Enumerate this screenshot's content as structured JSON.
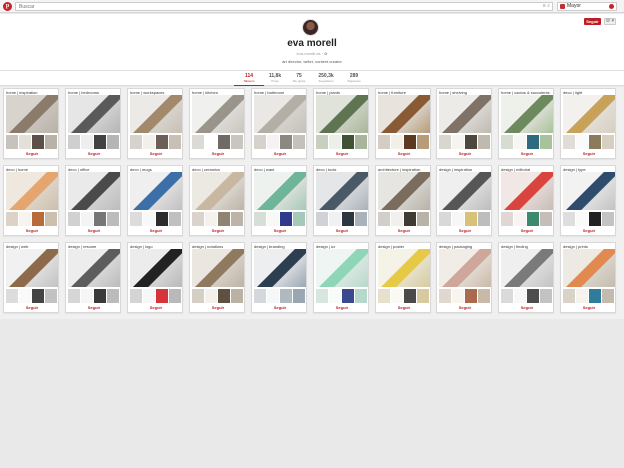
{
  "topbar": {
    "logo_letter": "p",
    "search_placeholder": "Buscar",
    "search_buttons": "≡ ⌕",
    "user_name": "Mayor"
  },
  "profile": {
    "follow_label": "Seguir",
    "settings_label": "⚙ ▾",
    "name": "eva morell",
    "site": "eva-morell.es · ✿",
    "bio": "art director, writer, content curator"
  },
  "stats": [
    {
      "num": "114",
      "label": "Tableros",
      "active": true
    },
    {
      "num": "11,8k",
      "label": "Pines",
      "active": false
    },
    {
      "num": "75",
      "label": "Me gusta",
      "active": false
    },
    {
      "num": "250,3k",
      "label": "Seguidores",
      "active": false
    },
    {
      "num": "289",
      "label": "Siguiendo",
      "active": false
    }
  ],
  "board_follow_label": "Seguir",
  "boards": [
    {
      "title": "home | inspiration",
      "colors": [
        "#d8d3cc",
        "#8b7b6a",
        "#c7c2bb",
        "#e3dfd9",
        "#5e5048",
        "#b9b2a8"
      ]
    },
    {
      "title": "home | bedrooms",
      "colors": [
        "#e6e6e6",
        "#5a5a5a",
        "#cfcfcf",
        "#eeeeee",
        "#424242",
        "#b5b5b5"
      ]
    },
    {
      "title": "home | workspaces",
      "colors": [
        "#eceae6",
        "#a3896c",
        "#d6d2cc",
        "#f2f0ec",
        "#6c6056",
        "#c8c0b4"
      ]
    },
    {
      "title": "home | kitchen",
      "colors": [
        "#f0f0ee",
        "#9a948a",
        "#dcdad6",
        "#ffffff",
        "#6f6a64",
        "#c9c6c0"
      ]
    },
    {
      "title": "home | bathroom",
      "colors": [
        "#e9e8e5",
        "#b3aea6",
        "#d5d2cc",
        "#f4f3f1",
        "#8c8780",
        "#c4c1bb"
      ]
    },
    {
      "title": "home | plants",
      "colors": [
        "#dfe3da",
        "#5f7450",
        "#c9cfbf",
        "#edf0e8",
        "#405135",
        "#a8b59a"
      ]
    },
    {
      "title": "home | furniture",
      "colors": [
        "#e8e4dd",
        "#8a5a34",
        "#d4cdc3",
        "#f2eee8",
        "#5c3a22",
        "#b89b78"
      ]
    },
    {
      "title": "home | shelving",
      "colors": [
        "#ecebe7",
        "#7f7368",
        "#d8d6d1",
        "#f5f4f1",
        "#4f463e",
        "#bfb9b0"
      ]
    },
    {
      "title": "home | cactus & succulents",
      "colors": [
        "#eef0ea",
        "#6d8a5e",
        "#d7dcd0",
        "#f6f7f3",
        "#2f6b7e",
        "#a9c29b"
      ]
    },
    {
      "title": "deco | light",
      "colors": [
        "#f3f1ee",
        "#c9a25a",
        "#e1ddd6",
        "#fafafa",
        "#8c7a5c",
        "#d7cfbf"
      ]
    },
    {
      "title": "deco | home",
      "colors": [
        "#efe8de",
        "#e6a46f",
        "#dcd3c6",
        "#f7f3ee",
        "#b76a3a",
        "#cdbfae"
      ]
    },
    {
      "title": "deco | office",
      "colors": [
        "#eaeaea",
        "#4a4a4a",
        "#d1d1d1",
        "#f4f4f4",
        "#767676",
        "#bcbcbc"
      ]
    },
    {
      "title": "deco | mugs",
      "colors": [
        "#efefef",
        "#3c6ea8",
        "#dcdcdc",
        "#f8f8f8",
        "#2c2c2c",
        "#c0c0c0"
      ]
    },
    {
      "title": "deco | ceramics",
      "colors": [
        "#ece8e2",
        "#c8b8a2",
        "#d9d3cb",
        "#f5f2ee",
        "#8f8372",
        "#bdb3a6"
      ]
    },
    {
      "title": "deco | want",
      "colors": [
        "#eef2ee",
        "#6fb59a",
        "#d6ded8",
        "#f7f9f7",
        "#2f3a8c",
        "#a5c9b9"
      ]
    },
    {
      "title": "deco | tools",
      "colors": [
        "#e4e6e8",
        "#495966",
        "#cfd3d7",
        "#eff1f3",
        "#2c3640",
        "#a9b2ba"
      ]
    },
    {
      "title": "architecture | inspiration",
      "colors": [
        "#e7e5e1",
        "#7a6d5e",
        "#d2cfc9",
        "#f1f0ed",
        "#3e3a34",
        "#b8b2a8"
      ]
    },
    {
      "title": "design | inspiration",
      "colors": [
        "#efefef",
        "#565656",
        "#d8d8d8",
        "#f7f7f7",
        "#d8c27a",
        "#bdbdbd"
      ]
    },
    {
      "title": "design | editorial",
      "colors": [
        "#f1e8e6",
        "#d9443e",
        "#e0d6d3",
        "#f8f4f3",
        "#3b8a6e",
        "#c8bcb8"
      ]
    },
    {
      "title": "design | type",
      "colors": [
        "#f2f2f2",
        "#2f4b6e",
        "#dedede",
        "#fafafa",
        "#222222",
        "#c3c3c3"
      ]
    },
    {
      "title": "design | web",
      "colors": [
        "#f1f1f1",
        "#8c6a4a",
        "#dcdcdc",
        "#f9f9f9",
        "#444444",
        "#c2c2c2"
      ]
    },
    {
      "title": "design | resume",
      "colors": [
        "#ededed",
        "#5d5d5d",
        "#d6d6d6",
        "#f6f6f6",
        "#3a3a3a",
        "#bbbbbb"
      ]
    },
    {
      "title": "design | logo",
      "colors": [
        "#ececec",
        "#222222",
        "#d4d4d4",
        "#f7f7f7",
        "#d6343a",
        "#b9b9b9"
      ]
    },
    {
      "title": "design | notations",
      "colors": [
        "#ebe6df",
        "#8f7a5f",
        "#d5cec4",
        "#f4f1ec",
        "#5f5142",
        "#bcb2a4"
      ]
    },
    {
      "title": "design | branding",
      "colors": [
        "#eceef0",
        "#2c3e50",
        "#d4d8dc",
        "#f6f7f8",
        "#b0b8c0",
        "#9aa6b2"
      ]
    },
    {
      "title": "design | ux",
      "colors": [
        "#eef5f2",
        "#8fd6b9",
        "#d8e6e0",
        "#f7fbf9",
        "#3a4a8c",
        "#b6d8cb"
      ]
    },
    {
      "title": "design | poster",
      "colors": [
        "#f5f2e8",
        "#e7c948",
        "#e6e0cc",
        "#fbf9f3",
        "#4a4a4a",
        "#d6ca9e"
      ]
    },
    {
      "title": "design | packaging",
      "colors": [
        "#f1ece6",
        "#cfa79a",
        "#e0d8ce",
        "#f8f5f1",
        "#a96a4e",
        "#c9b9a9"
      ]
    },
    {
      "title": "design | finding",
      "colors": [
        "#efefef",
        "#7a7a7a",
        "#dadada",
        "#f7f7f7",
        "#4d4d4d",
        "#c3c3c3"
      ]
    },
    {
      "title": "design | prints",
      "colors": [
        "#ede9e3",
        "#e08a4f",
        "#d8d2c9",
        "#f6f3ef",
        "#2f7d9a",
        "#c4bbae"
      ]
    }
  ]
}
